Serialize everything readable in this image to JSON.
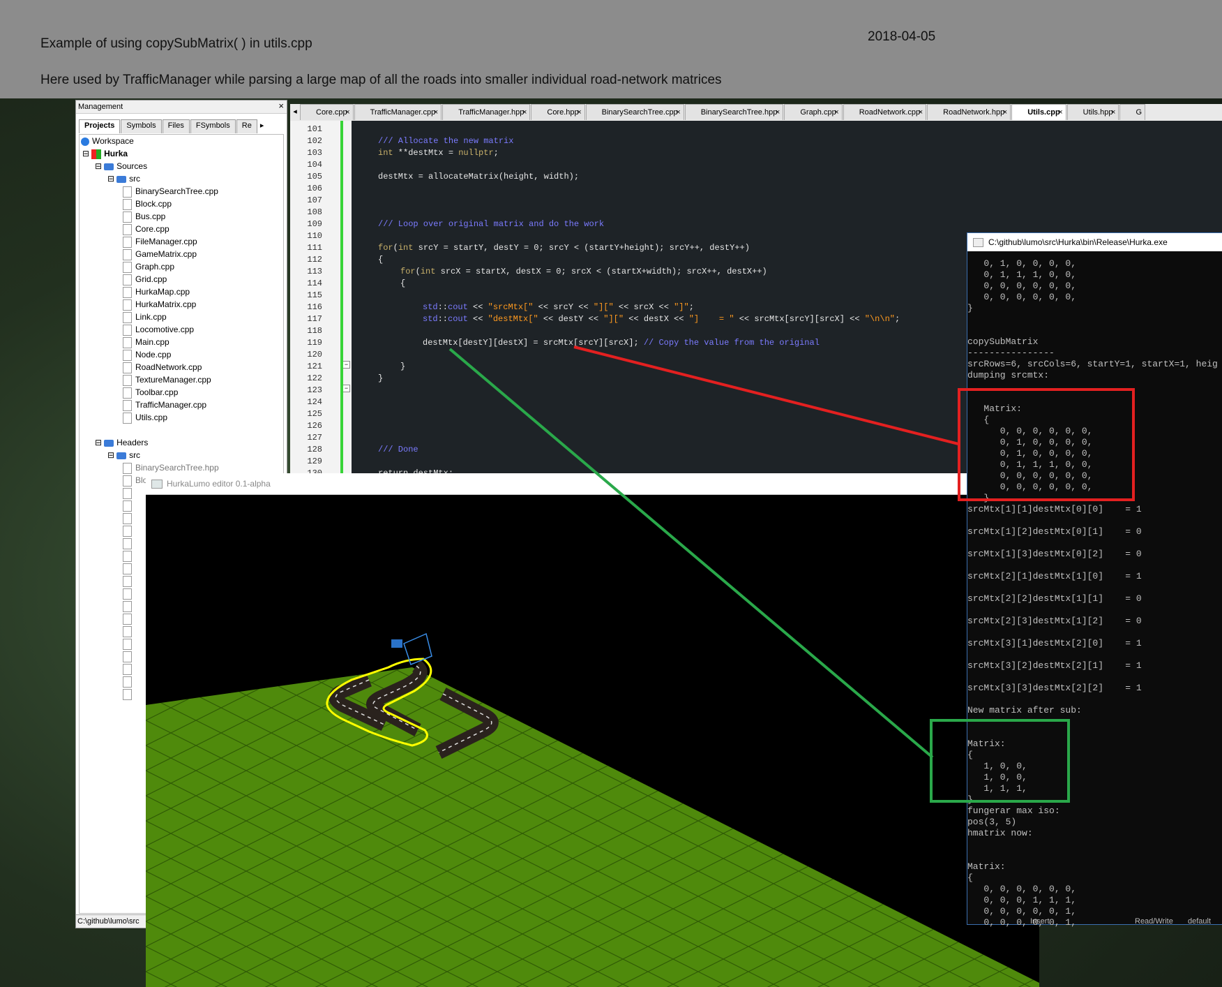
{
  "header": {
    "title": "Example of using copySubMatrix( ) in utils.cpp",
    "date": "2018-04-05",
    "description": "Here used by TrafficManager while parsing a large map of all the roads into smaller individual road-network matrices"
  },
  "management": {
    "title": "Management",
    "close_icon": "×",
    "tabs": [
      "Projects",
      "Symbols",
      "Files",
      "FSymbols",
      "Re"
    ],
    "scroll_icon": "▸",
    "tree": {
      "workspace": "Workspace",
      "project": "Hurka",
      "sources": "Sources",
      "src": "src",
      "source_files": [
        "BinarySearchTree.cpp",
        "Block.cpp",
        "Bus.cpp",
        "Core.cpp",
        "FileManager.cpp",
        "GameMatrix.cpp",
        "Graph.cpp",
        "Grid.cpp",
        "HurkaMap.cpp",
        "HurkaMatrix.cpp",
        "Link.cpp",
        "Locomotive.cpp",
        "Main.cpp",
        "Node.cpp",
        "RoadNetwork.cpp",
        "TextureManager.cpp",
        "Toolbar.cpp",
        "TrafficManager.cpp",
        "Utils.cpp"
      ],
      "headers": "Headers",
      "headers_src": "src",
      "header_files": [
        "BinarySearchTree.hpp",
        "Block.hpp"
      ]
    },
    "status_path": "C:\\github\\lumo\\src"
  },
  "editor": {
    "tabs": [
      "Core.cpp",
      "TrafficManager.cpp",
      "TrafficManager.hpp",
      "Core.hpp",
      "BinarySearchTree.cpp",
      "BinarySearchTree.hpp",
      "Graph.cpp",
      "RoadNetwork.cpp",
      "RoadNetwork.hpp",
      "Utils.cpp",
      "Utils.hpp",
      "G"
    ],
    "active_tab": "Utils.cpp",
    "line_numbers": [
      "101",
      "102",
      "103",
      "104",
      "105",
      "106",
      "107",
      "108",
      "109",
      "110",
      "111",
      "112",
      "113",
      "114",
      "115",
      "116",
      "117",
      "118",
      "119",
      "120",
      "121",
      "122",
      "123",
      "124",
      "125",
      "126",
      "127",
      "128",
      "129",
      "130"
    ],
    "lines": {
      "l102": "/// Allocate the new matrix",
      "l103_kw": "int",
      "l103_a": " **destMtx = ",
      "l103_b": "nullptr",
      "l103_c": ";",
      "l105": "destMtx = allocateMatrix(height, width);",
      "l109": "/// Loop over original matrix and do the work",
      "l111_kw": "for",
      "l111_a": "(",
      "l111_kw2": "int",
      "l111_b": " srcY = startY, destY = 0; srcY < (startY+height); srcY++, destY++)",
      "l112": "{",
      "l113_kw": "for",
      "l113_a": "(",
      "l113_kw2": "int",
      "l113_b": " srcX = startX, destX = 0; srcX < (startX+width); srcX++, destX++)",
      "l114": "{",
      "l116_a": "std",
      "l116_b": "::",
      "l116_c": "cout",
      "l116_d": " << ",
      "l116_s1": "\"srcMtx[\"",
      "l116_e": " << srcY << ",
      "l116_s2": "\"][\"",
      "l116_f": " << srcX << ",
      "l116_s3": "\"]\"",
      "l116_g": ";",
      "l117_a": "std",
      "l117_b": "::",
      "l117_c": "cout",
      "l117_d": " << ",
      "l117_s1": "\"destMtx[\"",
      "l117_e": " << destY << ",
      "l117_s2": "\"][\"",
      "l117_f": " << destX << ",
      "l117_s3": "\"]    = \"",
      "l117_g": " << srcMtx[srcY][srcX] << ",
      "l117_s4": "\"\\n\\n\"",
      "l117_h": ";",
      "l119_a": "destMtx[destY][destX] = srcMtx[srcY][srcX]; ",
      "l119_c": "// Copy the value from the original",
      "l121": "}",
      "l122": "}",
      "l128": "/// Done",
      "l130": "return destMtx;"
    }
  },
  "game_window": {
    "title": "HurkaLumo editor 0.1-alpha"
  },
  "console": {
    "title": "C:\\github\\lumo\\src\\Hurka\\bin\\Release\\Hurka.exe",
    "output": "   0, 1, 0, 0, 0, 0,\n   0, 1, 1, 1, 0, 0,\n   0, 0, 0, 0, 0, 0,\n   0, 0, 0, 0, 0, 0,\n}\n\n\ncopySubMatrix\n----------------\nsrcRows=6, srcCols=6, startY=1, startX=1, heig\ndumping srcmtx:\n\n\n   Matrix:\n   {\n      0, 0, 0, 0, 0, 0,\n      0, 1, 0, 0, 0, 0,\n      0, 1, 0, 0, 0, 0,\n      0, 1, 1, 1, 0, 0,\n      0, 0, 0, 0, 0, 0,\n      0, 0, 0, 0, 0, 0,\n   }\nsrcMtx[1][1]destMtx[0][0]    = 1\n\nsrcMtx[1][2]destMtx[0][1]    = 0\n\nsrcMtx[1][3]destMtx[0][2]    = 0\n\nsrcMtx[2][1]destMtx[1][0]    = 1\n\nsrcMtx[2][2]destMtx[1][1]    = 0\n\nsrcMtx[2][3]destMtx[1][2]    = 0\n\nsrcMtx[3][1]destMtx[2][0]    = 1\n\nsrcMtx[3][2]destMtx[2][1]    = 1\n\nsrcMtx[3][3]destMtx[2][2]    = 1\n\nNew matrix after sub:\n\n\nMatrix:\n{\n   1, 0, 0,\n   1, 0, 0,\n   1, 1, 1,\n}\nfungerar max iso:\npos(3, 5)\nhmatrix now:\n\n\nMatrix:\n{\n   0, 0, 0, 0, 0, 0,\n   0, 0, 0, 1, 1, 1,\n   0, 0, 0, 0, 0, 1,\n   0, 0, 0, 0, 0, 1,",
    "status_insert": "Insert",
    "status_rw": "Read/Write",
    "status_default": "default"
  },
  "colors": {
    "grass": "#4f8a0c",
    "road": "#2a221d",
    "highlight_yellow": "#ffff00",
    "annotation_red": "#e32020",
    "annotation_green": "#2aa84a",
    "change_bar": "#38d438"
  }
}
